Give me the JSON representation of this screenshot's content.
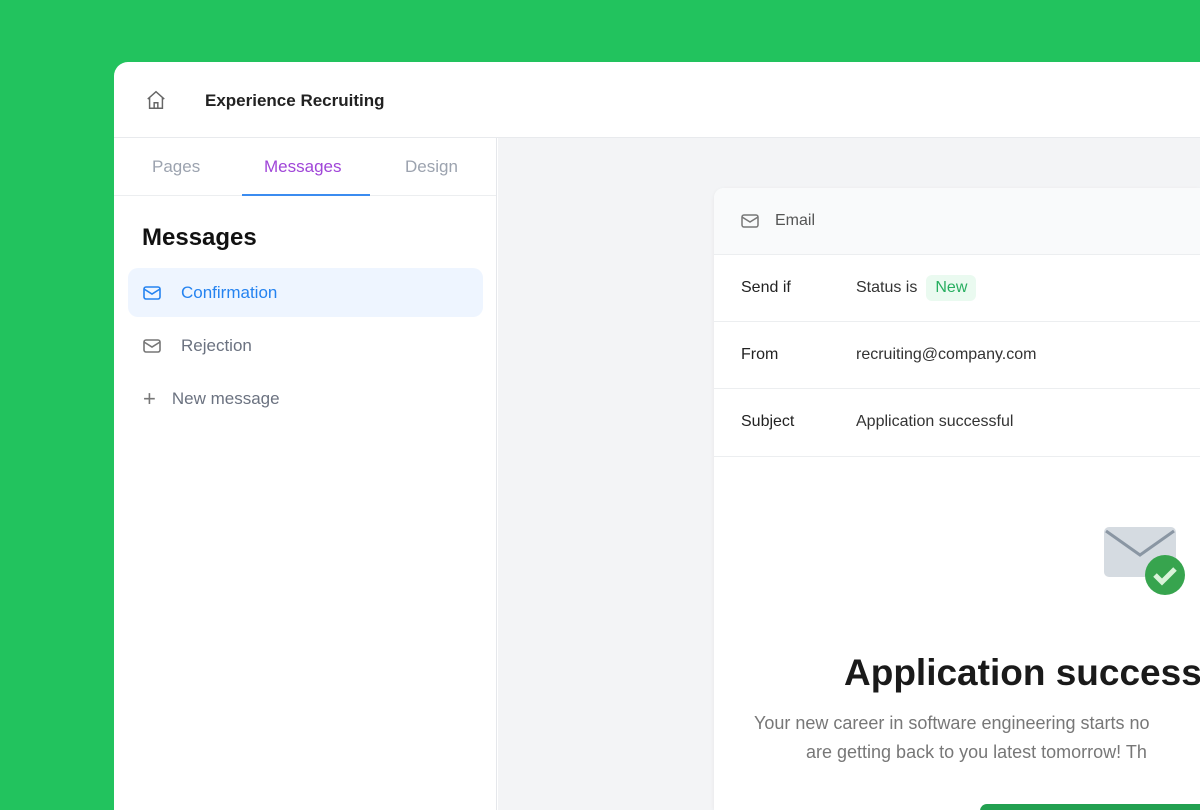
{
  "header": {
    "title": "Experience Recruiting",
    "home_icon": "home-icon"
  },
  "tabs": [
    {
      "label": "Pages"
    },
    {
      "label": "Messages",
      "active": true
    },
    {
      "label": "Design"
    }
  ],
  "sidebar": {
    "heading": "Messages",
    "items": [
      {
        "label": "Confirmation",
        "selected": true
      },
      {
        "label": "Rejection"
      }
    ],
    "new_label": "New message"
  },
  "email": {
    "header": "Email",
    "rows": {
      "send_if_label": "Send if",
      "status_text": "Status is",
      "status_badge": "New",
      "from_label": "From",
      "from_value": "recruiting@company.com",
      "subject_label": "Subject",
      "subject_value": "Application successful"
    },
    "preview": {
      "heading": "Application successf",
      "line1": "Your new career in software engineering starts no",
      "line2": "are getting back to you latest tomorrow! Th"
    }
  },
  "colors": {
    "brand_green": "#22c35e",
    "tab_active": "#a046d8",
    "selected": "#2583f0"
  }
}
